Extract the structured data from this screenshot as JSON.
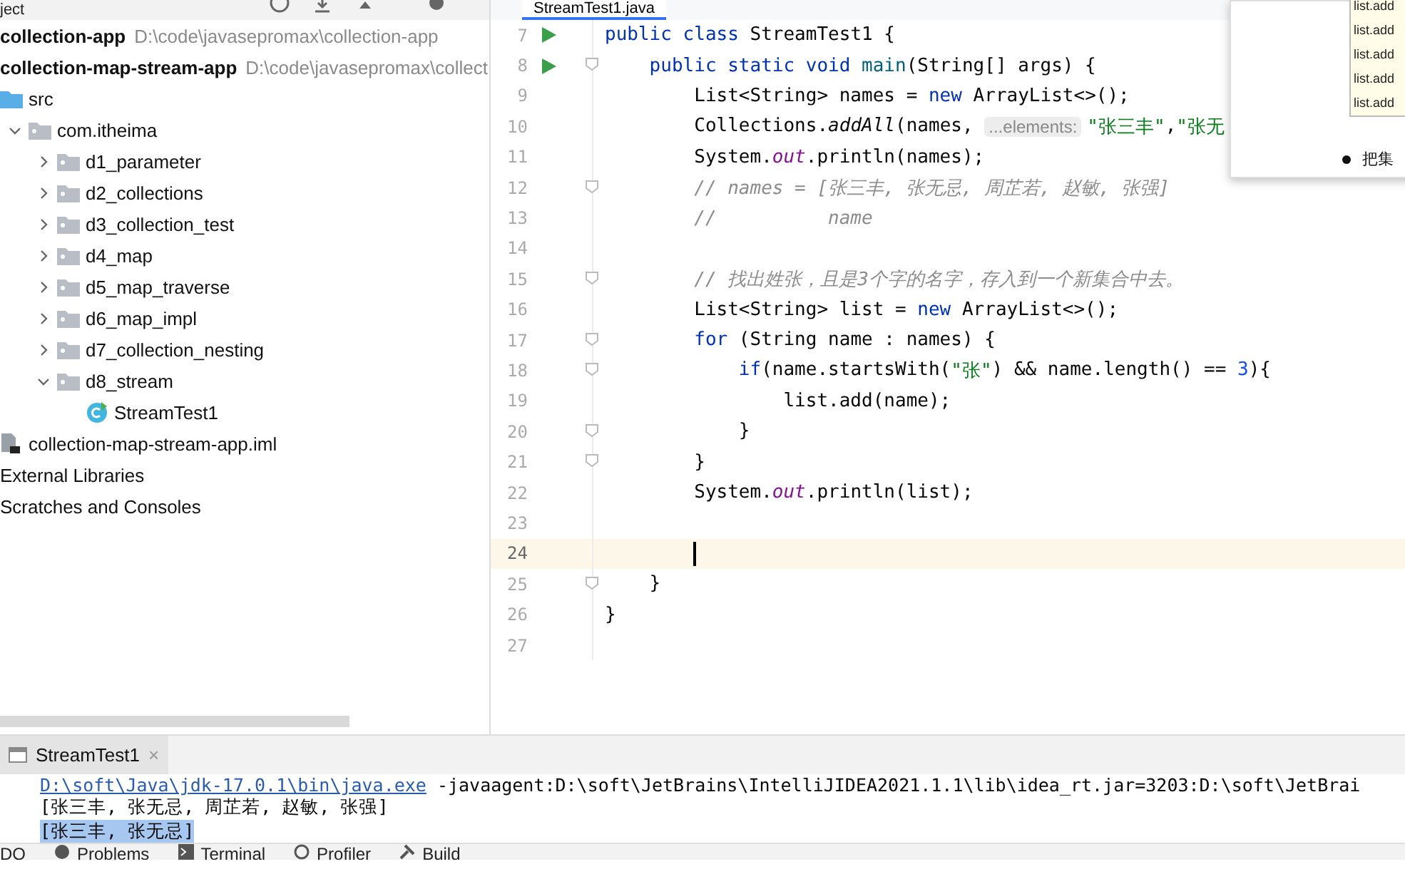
{
  "project_panel": {
    "title": "ject",
    "tree": [
      {
        "label": "collection-app",
        "path": "D:\\code\\javasepromax\\collection-app",
        "kind": "module"
      },
      {
        "label": "collection-map-stream-app",
        "path": "D:\\code\\javasepromax\\collect",
        "kind": "module",
        "children": [
          {
            "label": "src",
            "kind": "source",
            "children": [
              {
                "label": "com.itheima",
                "kind": "package",
                "expanded": true,
                "children": [
                  {
                    "label": "d1_parameter",
                    "kind": "package",
                    "expanded": false
                  },
                  {
                    "label": "d2_collections",
                    "kind": "package",
                    "expanded": false
                  },
                  {
                    "label": "d3_collection_test",
                    "kind": "package",
                    "expanded": false
                  },
                  {
                    "label": "d4_map",
                    "kind": "package",
                    "expanded": false
                  },
                  {
                    "label": "d5_map_traverse",
                    "kind": "package",
                    "expanded": false
                  },
                  {
                    "label": "d6_map_impl",
                    "kind": "package",
                    "expanded": false
                  },
                  {
                    "label": "d7_collection_nesting",
                    "kind": "package",
                    "expanded": false
                  },
                  {
                    "label": "d8_stream",
                    "kind": "package",
                    "expanded": true,
                    "children": [
                      {
                        "label": "StreamTest1",
                        "kind": "class"
                      }
                    ]
                  }
                ]
              }
            ]
          },
          {
            "label": "collection-map-stream-app.iml",
            "kind": "file"
          }
        ]
      },
      {
        "label": "External Libraries",
        "kind": "plain"
      },
      {
        "label": "Scratches and Consoles",
        "kind": "plain"
      }
    ]
  },
  "editor": {
    "tab": {
      "label": "StreamTest1.java",
      "selected": true
    },
    "lines": [
      {
        "number": "7",
        "run": true,
        "fold": false,
        "current": false,
        "tokens": [
          {
            "kind": "keyword",
            "text": "public class "
          },
          {
            "kind": "plain",
            "text": "StreamTest1 {"
          }
        ]
      },
      {
        "number": "8",
        "run": true,
        "fold": true,
        "current": false,
        "tokens": [
          {
            "kind": "keyword",
            "text": "    public static void "
          },
          {
            "kind": "method",
            "text": "main"
          },
          {
            "kind": "plain",
            "text": "(String[] args) {"
          }
        ]
      },
      {
        "number": "9",
        "run": false,
        "fold": false,
        "current": false,
        "tokens": [
          {
            "kind": "plain",
            "text": "        List<String> names = "
          },
          {
            "kind": "keyword",
            "text": "new "
          },
          {
            "kind": "plain",
            "text": "ArrayList<>();"
          }
        ]
      },
      {
        "number": "10",
        "run": false,
        "fold": false,
        "current": false,
        "tokens": [
          {
            "kind": "plain",
            "text": "        Collections."
          },
          {
            "kind": "italic",
            "text": "addAll"
          },
          {
            "kind": "plain",
            "text": "(names, "
          },
          {
            "kind": "hint",
            "text": "...elements:"
          },
          {
            "kind": "string",
            "text": "\"张三丰\""
          },
          {
            "kind": "plain",
            "text": ","
          },
          {
            "kind": "string",
            "text": "\"张无"
          }
        ]
      },
      {
        "number": "11",
        "run": false,
        "fold": false,
        "current": false,
        "tokens": [
          {
            "kind": "plain",
            "text": "        System."
          },
          {
            "kind": "field",
            "text": "out"
          },
          {
            "kind": "plain",
            "text": ".println(names);"
          }
        ]
      },
      {
        "number": "12",
        "run": false,
        "fold": true,
        "current": false,
        "tokens": [
          {
            "kind": "comment",
            "text": "        // names = [张三丰, 张无忌, 周芷若, 赵敏, 张强]"
          }
        ]
      },
      {
        "number": "13",
        "run": false,
        "fold": false,
        "current": false,
        "tokens": [
          {
            "kind": "comment",
            "text": "        //          name"
          }
        ]
      },
      {
        "number": "14",
        "run": false,
        "fold": false,
        "current": false
      },
      {
        "number": "15",
        "run": false,
        "fold": true,
        "current": false,
        "tokens": [
          {
            "kind": "comment",
            "text": "        // 找出姓张，且是3个字的名字，存入到一个新集合中去。"
          }
        ]
      },
      {
        "number": "16",
        "run": false,
        "fold": false,
        "current": false,
        "tokens": [
          {
            "kind": "plain",
            "text": "        List<String> list = "
          },
          {
            "kind": "keyword",
            "text": "new "
          },
          {
            "kind": "plain",
            "text": "ArrayList<>();"
          }
        ]
      },
      {
        "number": "17",
        "run": false,
        "fold": true,
        "current": false,
        "tokens": [
          {
            "kind": "keyword",
            "text": "        for "
          },
          {
            "kind": "plain",
            "text": "(String name : names) {"
          }
        ]
      },
      {
        "number": "18",
        "run": false,
        "fold": true,
        "current": false,
        "tokens": [
          {
            "kind": "keyword",
            "text": "            if"
          },
          {
            "kind": "plain",
            "text": "(name.startsWith("
          },
          {
            "kind": "string",
            "text": "\"张\""
          },
          {
            "kind": "plain",
            "text": ") && name.length() == "
          },
          {
            "kind": "number",
            "text": "3"
          },
          {
            "kind": "plain",
            "text": "){"
          }
        ]
      },
      {
        "number": "19",
        "run": false,
        "fold": false,
        "current": false,
        "tokens": [
          {
            "kind": "plain",
            "text": "                list.add(name);"
          }
        ]
      },
      {
        "number": "20",
        "run": false,
        "fold": true,
        "current": false,
        "tokens": [
          {
            "kind": "plain",
            "text": "            }"
          }
        ]
      },
      {
        "number": "21",
        "run": false,
        "fold": true,
        "current": false,
        "tokens": [
          {
            "kind": "plain",
            "text": "        }"
          }
        ]
      },
      {
        "number": "22",
        "run": false,
        "fold": false,
        "current": false,
        "tokens": [
          {
            "kind": "plain",
            "text": "        System."
          },
          {
            "kind": "field",
            "text": "out"
          },
          {
            "kind": "plain",
            "text": ".println(list);"
          }
        ]
      },
      {
        "number": "23",
        "run": false,
        "fold": false,
        "current": false
      },
      {
        "number": "24",
        "run": false,
        "fold": false,
        "current": true
      },
      {
        "number": "25",
        "run": false,
        "fold": true,
        "current": false,
        "tokens": [
          {
            "kind": "plain",
            "text": "    }"
          }
        ]
      },
      {
        "number": "26",
        "run": false,
        "fold": false,
        "current": false,
        "tokens": [
          {
            "kind": "plain",
            "text": "}"
          }
        ]
      },
      {
        "number": "27",
        "run": false,
        "fold": false,
        "current": false
      }
    ]
  },
  "popup": {
    "items": [
      "list.add",
      "list.add",
      "list.add",
      "list.add",
      "list.add"
    ],
    "note": "把集"
  },
  "run_panel": {
    "tab": {
      "label": "StreamTest1",
      "close": "×",
      "selected": true
    },
    "lines": [
      {
        "selected": false,
        "tokens": [
          {
            "kind": "link",
            "text": "D:\\soft\\Java\\jdk-17.0.1\\bin\\java.exe"
          },
          {
            "kind": "plain",
            "text": " -javaagent:D:\\soft\\JetBrains\\IntelliJIDEA2021.1.1\\lib\\idea_rt.jar=3203:D:\\soft\\JetBrai"
          }
        ]
      },
      {
        "selected": false,
        "tokens": [
          {
            "kind": "plain",
            "text": "[张三丰, 张无忌, 周芷若, 赵敏, 张强]"
          }
        ]
      },
      {
        "selected": true,
        "tokens": [
          {
            "kind": "plain",
            "text": "[张三丰, 张无忌]"
          }
        ]
      }
    ]
  },
  "tool_tabs": [
    {
      "label": "DO",
      "kind": "plain"
    },
    {
      "label": "Problems",
      "kind": "problems"
    },
    {
      "label": "Terminal",
      "kind": "terminal"
    },
    {
      "label": "Profiler",
      "kind": "profiler"
    },
    {
      "label": "Build",
      "kind": "build"
    }
  ]
}
